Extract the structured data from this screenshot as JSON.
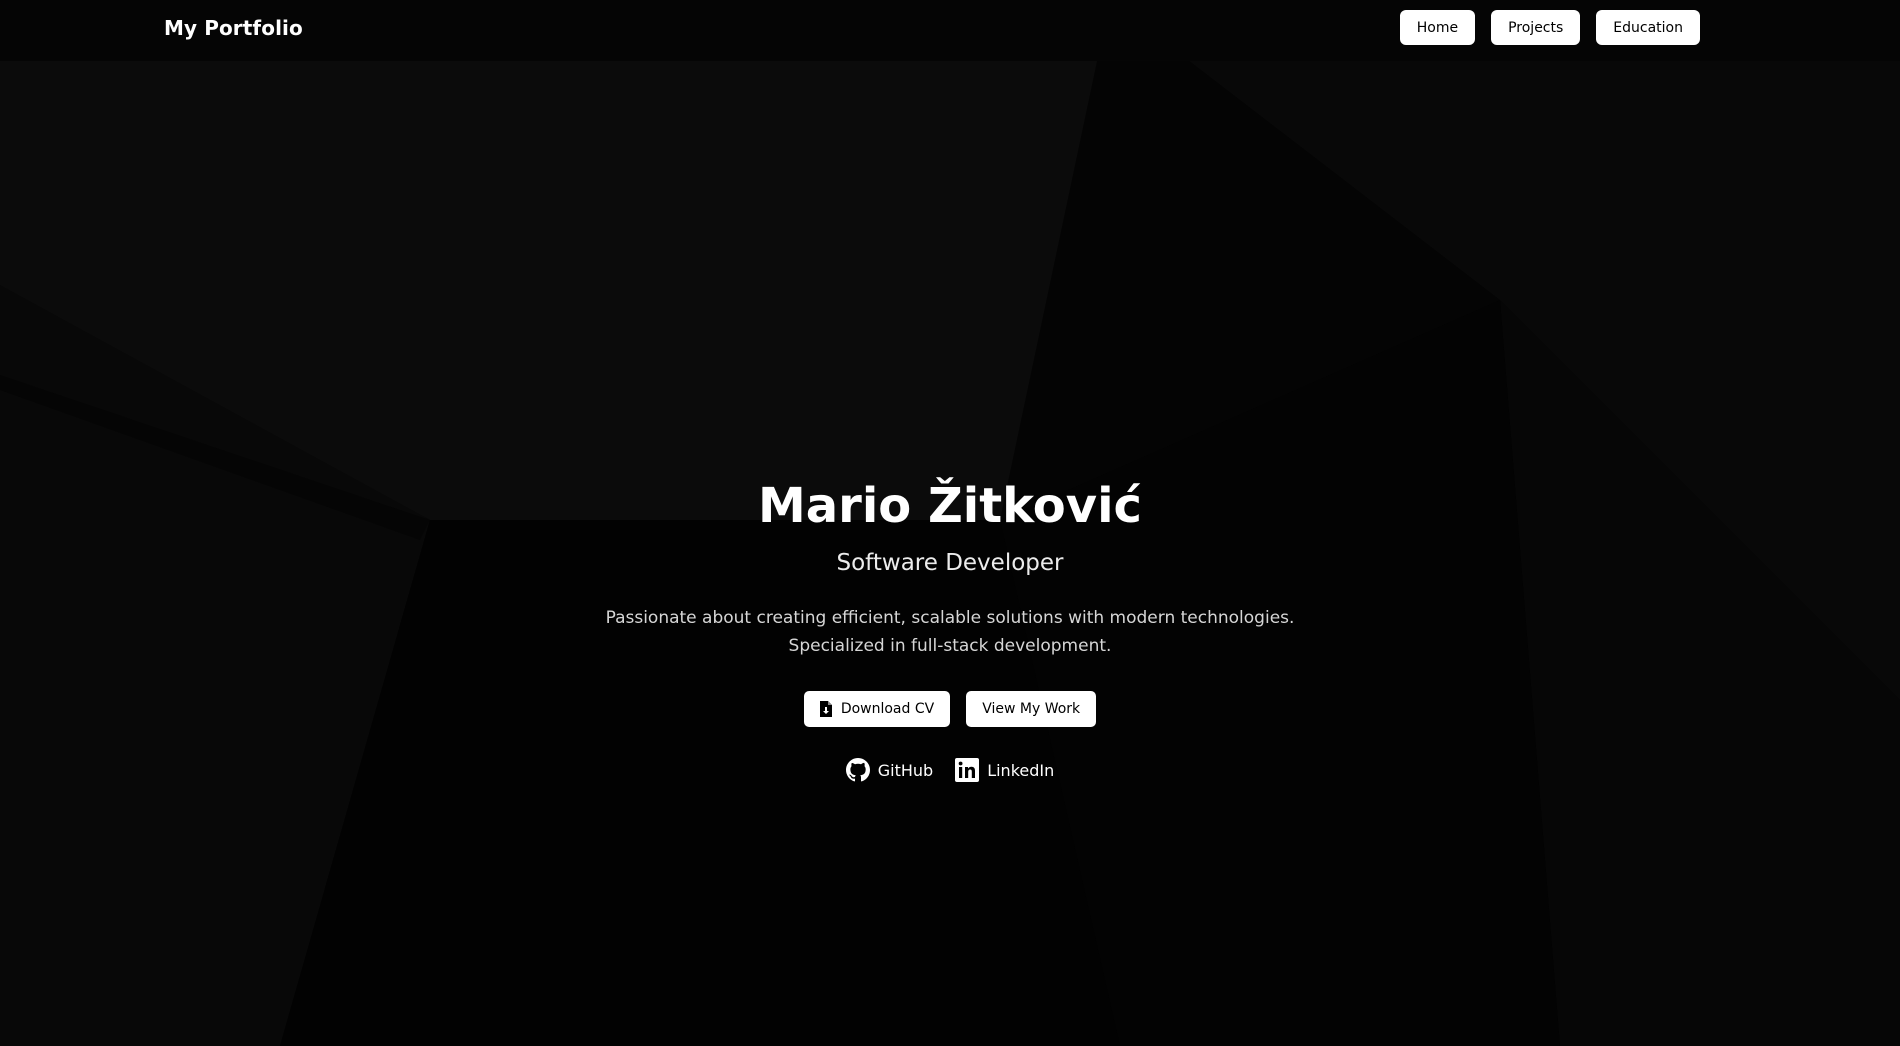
{
  "brand": "My Portfolio",
  "nav": {
    "home": "Home",
    "projects": "Projects",
    "education": "Education"
  },
  "hero": {
    "name": "Mario Žitković",
    "role": "Software Developer",
    "desc_line1": "Passionate about creating efficient, scalable solutions with modern technologies.",
    "desc_line2": "Specialized in full-stack development."
  },
  "cta": {
    "download_cv": "Download CV",
    "download_icon": "file-download-icon",
    "view_work": "View My Work"
  },
  "social": {
    "github": "GitHub",
    "github_icon": "github-icon",
    "linkedin": "LinkedIn",
    "linkedin_icon": "linkedin-icon"
  },
  "colors": {
    "background": "#030303",
    "navbar": "#050505",
    "button_bg": "#ffffff",
    "button_text": "#000000",
    "text_primary": "#ffffff",
    "text_secondary": "#d6d6d6"
  }
}
